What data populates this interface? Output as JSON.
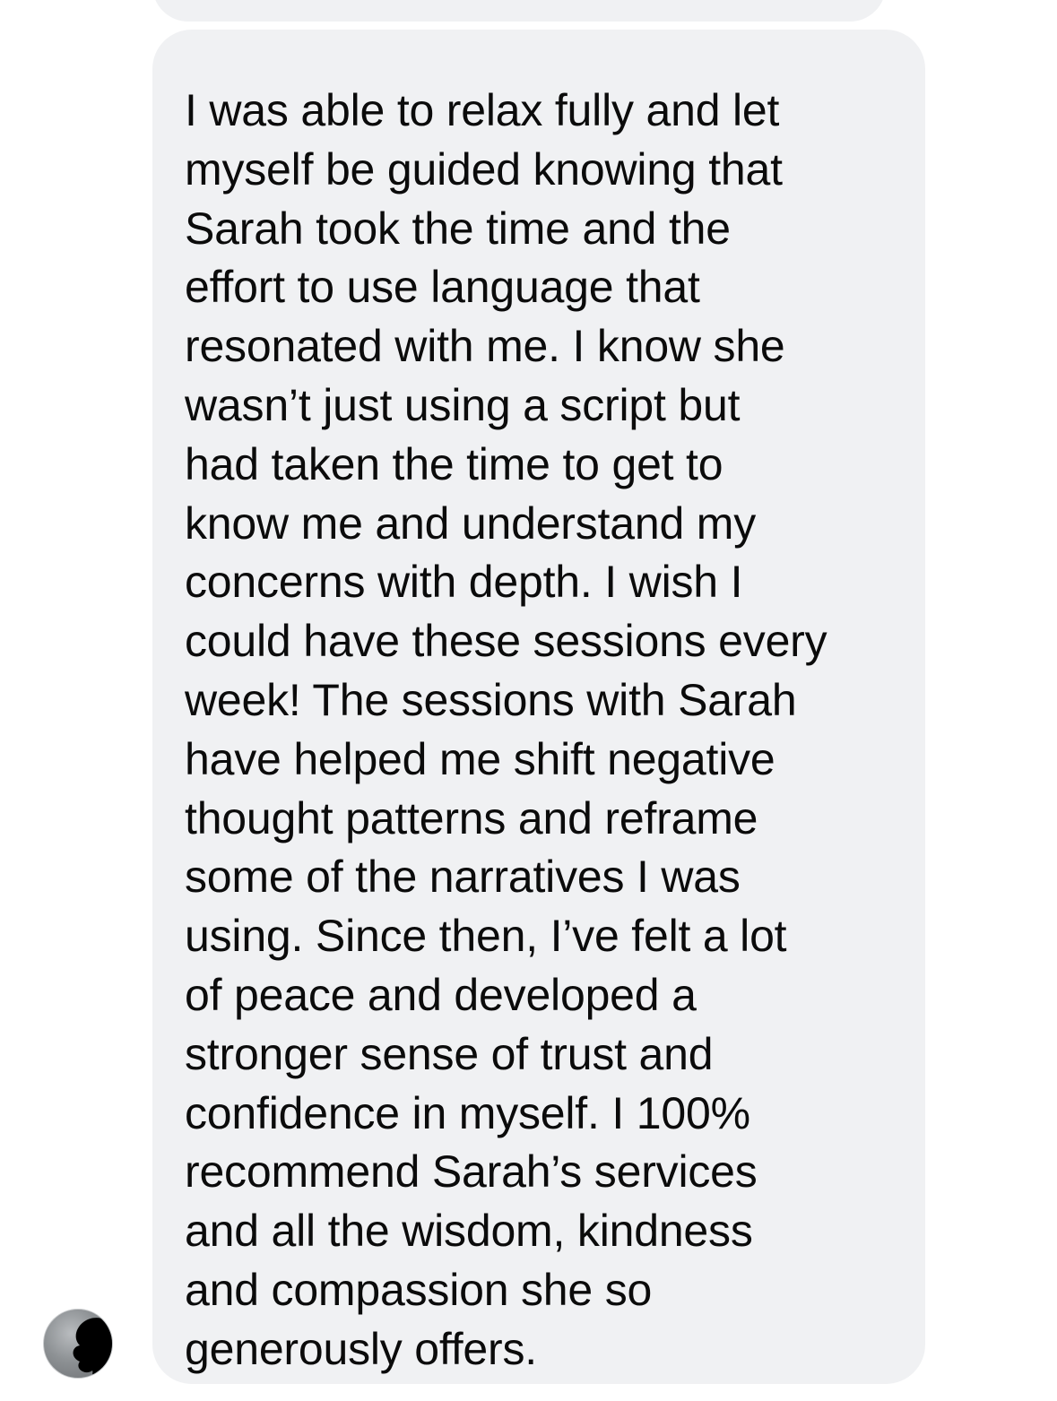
{
  "thread": {
    "message": {
      "text": "I was able to relax fully and let\nmyself be guided knowing that\nSarah took the time and the\neffort to use language that\nresonated with me. I know she\nwasn’t just using a script but\nhad taken the time to get to\nknow me and understand my\nconcerns with depth. I wish I\ncould have these sessions every\nweek! The sessions with Sarah\nhave helped me shift negative\nthought patterns and reframe\nsome of the narratives I was\nusing. Since then, I’ve felt a lot\nof peace and developed a\nstronger sense of trust and\nconfidence in myself. I 100%\nrecommend Sarah’s services\nand all the wisdom, kindness\nand compassion she so\ngenerously offers."
    }
  },
  "colors": {
    "bubble_background": "#f0f1f3",
    "text": "#0b0b0b",
    "redaction": "#000000"
  }
}
